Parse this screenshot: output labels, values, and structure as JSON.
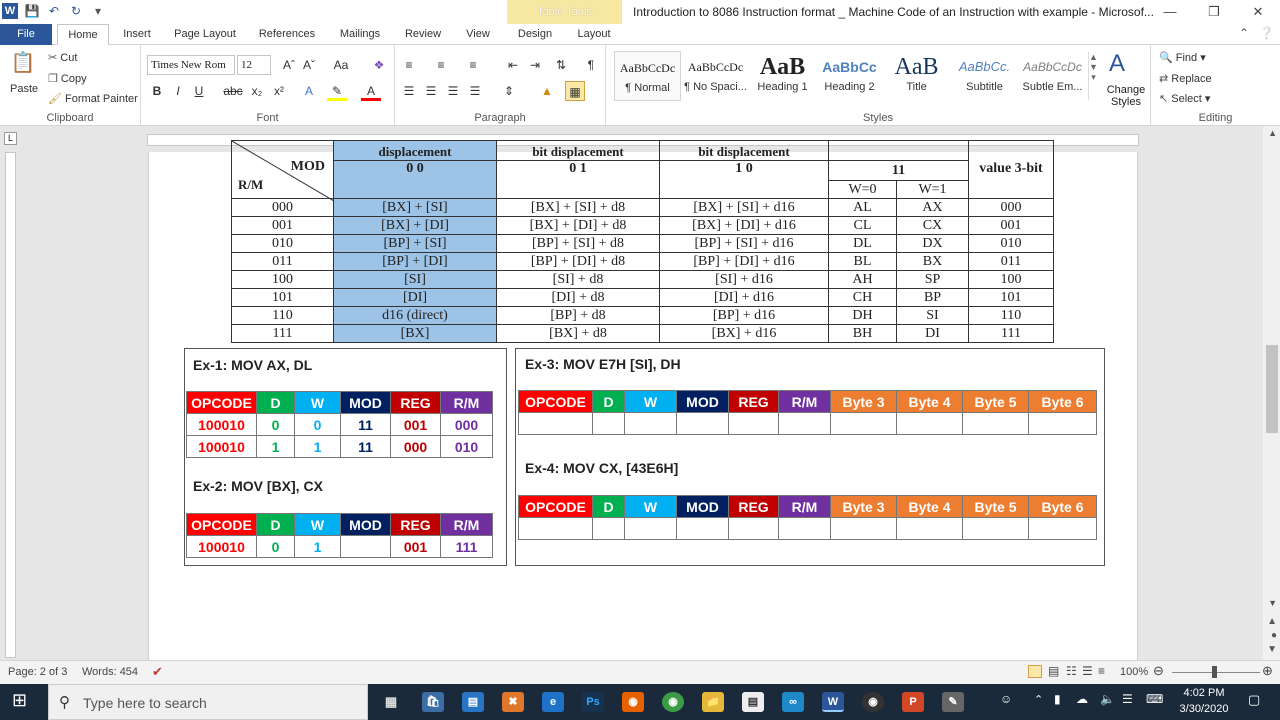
{
  "window": {
    "title": "Introduction to 8086 Instruction format _ Machine Code of an Instruction with example  -  Microsof...",
    "table_tools": "Table Tools"
  },
  "tabs": [
    "File",
    "Home",
    "Insert",
    "Page Layout",
    "References",
    "Mailings",
    "Review",
    "View",
    "Design",
    "Layout"
  ],
  "clipboard": {
    "paste": "Paste",
    "cut": "Cut",
    "copy": "Copy",
    "format_painter": "Format Painter",
    "label": "Clipboard"
  },
  "font": {
    "name": "Times New Rom",
    "size": "12",
    "label": "Font"
  },
  "paragraph": {
    "label": "Paragraph"
  },
  "styles": {
    "label": "Styles",
    "items": [
      {
        "sample": "AaBbCcDc",
        "name": "¶ Normal"
      },
      {
        "sample": "AaBbCcDc",
        "name": "¶ No Spaci..."
      },
      {
        "sample": "AaB",
        "name": "Heading 1"
      },
      {
        "sample": "AaBbCc",
        "name": "Heading 2"
      },
      {
        "sample": "AaB",
        "name": "Title"
      },
      {
        "sample": "AaBbCc.",
        "name": "Subtitle"
      },
      {
        "sample": "AaBbCcDc",
        "name": "Subtle Em..."
      }
    ],
    "change_styles": "Change Styles"
  },
  "editing": {
    "find": "Find",
    "replace": "Replace",
    "select": "Select",
    "label": "Editing"
  },
  "mod_table": {
    "header_top": [
      "displacement",
      "bit displacement",
      "bit displacement",
      "",
      "value 3-bit"
    ],
    "mod_label": "MOD",
    "rm_label": "R/M",
    "mod_values": [
      "0 0",
      "0 1",
      "1 0",
      "11"
    ],
    "w_labels": [
      "W=0",
      "W=1"
    ],
    "rows": [
      [
        "000",
        "[BX] + [SI]",
        "[BX] + [SI] + d8",
        "[BX] + [SI] + d16",
        "AL",
        "AX",
        "000"
      ],
      [
        "001",
        "[BX] + [DI]",
        "[BX] + [DI] + d8",
        "[BX] + [DI] + d16",
        "CL",
        "CX",
        "001"
      ],
      [
        "010",
        "[BP] + [SI]",
        "[BP] + [SI] + d8",
        "[BP] + [SI] + d16",
        "DL",
        "DX",
        "010"
      ],
      [
        "011",
        "[BP] + [DI]",
        "[BP] + [DI] + d8",
        "[BP] + [DI] + d16",
        "BL",
        "BX",
        "011"
      ],
      [
        "100",
        "[SI]",
        "[SI] + d8",
        "[SI] + d16",
        "AH",
        "SP",
        "100"
      ],
      [
        "101",
        "[DI]",
        "[DI] + d8",
        "[DI] + d16",
        "CH",
        "BP",
        "101"
      ],
      [
        "110",
        "d16 (direct)",
        "[BP] + d8",
        "[BP] + d16",
        "DH",
        "SI",
        "110"
      ],
      [
        "111",
        "[BX]",
        "[BX] + d8",
        "[BX] + d16",
        "BH",
        "DI",
        "111"
      ]
    ]
  },
  "examples": {
    "headers_short": [
      "OPCODE",
      "D",
      "W",
      "MOD",
      "REG",
      "R/M"
    ],
    "headers_long": [
      "OPCODE",
      "D",
      "W",
      "MOD",
      "REG",
      "R/M",
      "Byte 3",
      "Byte 4",
      "Byte 5",
      "Byte 6"
    ],
    "ex1": {
      "title": "Ex-1: MOV AX, DL",
      "rows": [
        [
          "100010",
          "0",
          "0",
          "11",
          "001",
          "000"
        ],
        [
          "100010",
          "1",
          "1",
          "11",
          "000",
          "010"
        ]
      ]
    },
    "ex2": {
      "title": "Ex-2:  MOV [BX], CX",
      "rows": [
        [
          "100010",
          "0",
          "1",
          "",
          "001",
          "111"
        ]
      ]
    },
    "ex3": {
      "title": "Ex-3: MOV E7H [SI], DH"
    },
    "ex4": {
      "title": "Ex-4: MOV CX, [43E6H]"
    }
  },
  "status": {
    "page": "Page: 2 of 3",
    "words": "Words: 454",
    "zoom": "100%"
  },
  "taskbar": {
    "search_placeholder": "Type here to search",
    "time": "4:02 PM",
    "date": "3/30/2020"
  }
}
